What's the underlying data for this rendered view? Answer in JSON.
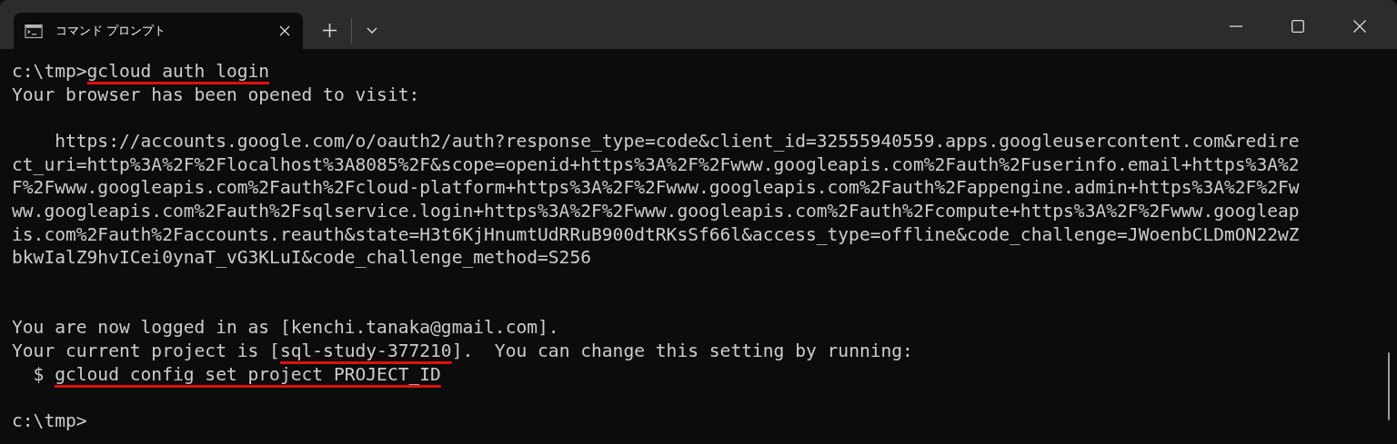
{
  "tab": {
    "title": "コマンド プロンプト",
    "selected": true
  },
  "lines": [
    {
      "kind": "text",
      "parts": [
        {
          "text": "c:\\tmp>",
          "underlined": false
        },
        {
          "text": "gcloud auth login",
          "underlined": true
        }
      ]
    },
    {
      "kind": "text",
      "parts": [
        {
          "text": "Your browser has been opened to visit:",
          "underlined": false
        }
      ]
    },
    {
      "kind": "blank"
    },
    {
      "kind": "text",
      "parts": [
        {
          "text": "    https://accounts.google.com/o/oauth2/auth?response_type=code&client_id=32555940559.apps.googleusercontent.com&redire",
          "underlined": false
        }
      ]
    },
    {
      "kind": "text",
      "parts": [
        {
          "text": "ct_uri=http%3A%2F%2Flocalhost%3A8085%2F&scope=openid+https%3A%2F%2Fwww.googleapis.com%2Fauth%2Fuserinfo.email+https%3A%2",
          "underlined": false
        }
      ]
    },
    {
      "kind": "text",
      "parts": [
        {
          "text": "F%2Fwww.googleapis.com%2Fauth%2Fcloud-platform+https%3A%2F%2Fwww.googleapis.com%2Fauth%2Fappengine.admin+https%3A%2F%2Fw",
          "underlined": false
        }
      ]
    },
    {
      "kind": "text",
      "parts": [
        {
          "text": "ww.googleapis.com%2Fauth%2Fsqlservice.login+https%3A%2F%2Fwww.googleapis.com%2Fauth%2Fcompute+https%3A%2F%2Fwww.googleap",
          "underlined": false
        }
      ]
    },
    {
      "kind": "text",
      "parts": [
        {
          "text": "is.com%2Fauth%2Faccounts.reauth&state=H3t6KjHnumtUdRRuB900dtRKsSf66l&access_type=offline&code_challenge=JWoenbCLDmON22wZ",
          "underlined": false
        }
      ]
    },
    {
      "kind": "text",
      "parts": [
        {
          "text": "bkwIalZ9hvICei0ynaT_vG3KLuI&code_challenge_method=S256",
          "underlined": false
        }
      ]
    },
    {
      "kind": "blank"
    },
    {
      "kind": "blank"
    },
    {
      "kind": "text",
      "parts": [
        {
          "text": "You are now logged in as [kenchi.tanaka@gmail.com].",
          "underlined": false
        }
      ]
    },
    {
      "kind": "text",
      "parts": [
        {
          "text": "Your current project is [",
          "underlined": false
        },
        {
          "text": "sql-study-377210",
          "underlined": true
        },
        {
          "text": "].  You can change this setting by running:",
          "underlined": false
        }
      ]
    },
    {
      "kind": "text",
      "parts": [
        {
          "text": "  $ ",
          "underlined": false
        },
        {
          "text": "gcloud config set project PROJECT_ID",
          "underlined": true
        }
      ]
    },
    {
      "kind": "blank"
    },
    {
      "kind": "text",
      "parts": [
        {
          "text": "c:\\tmp>",
          "underlined": false
        }
      ]
    }
  ]
}
